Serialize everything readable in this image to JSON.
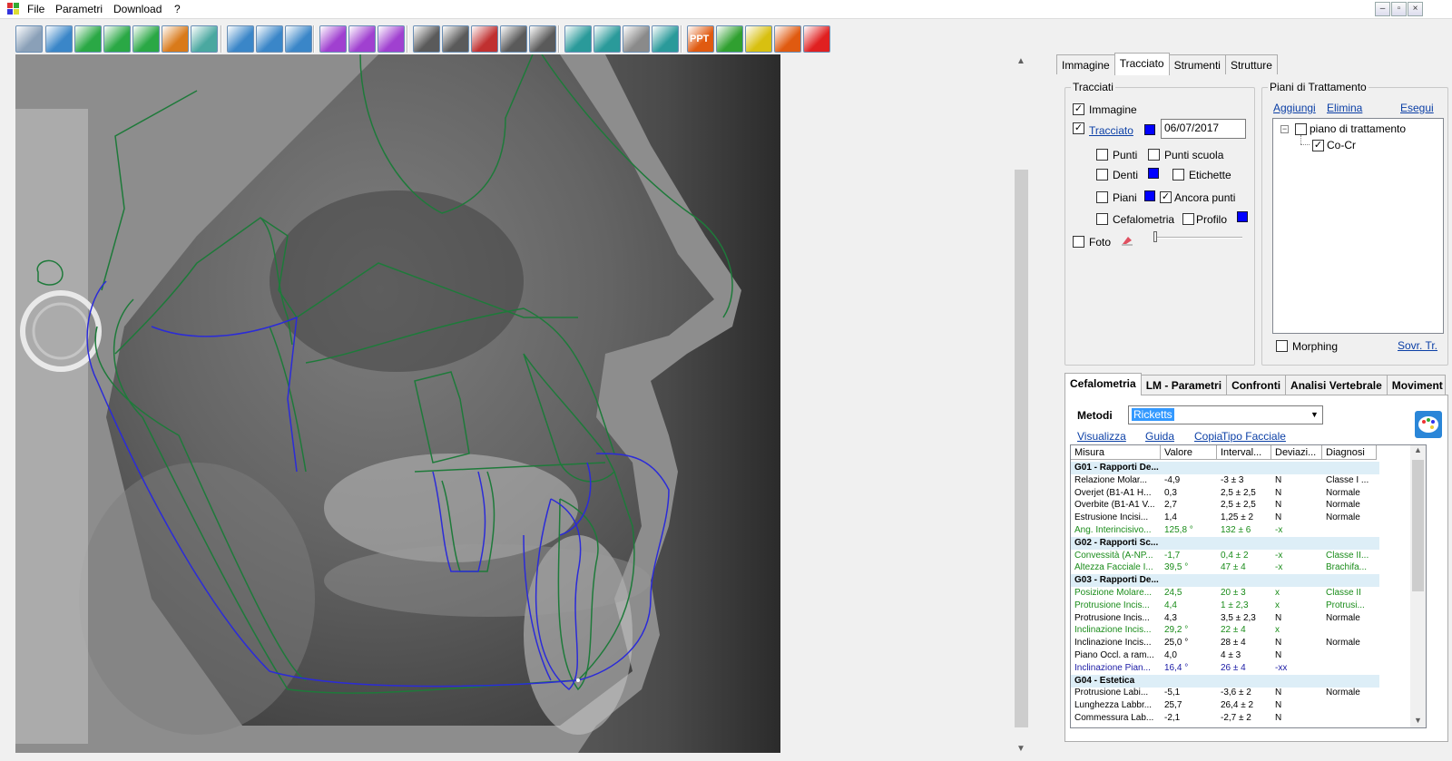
{
  "menubar": {
    "items": [
      "File",
      "Parametri",
      "Download",
      "?"
    ]
  },
  "window_controls": {
    "minimize": "–",
    "restore": "▫",
    "close": "×"
  },
  "toolbar": {
    "buttons": [
      {
        "name": "calibrate",
        "color": "#8aa0b8"
      },
      {
        "name": "zoom-point",
        "color": "#3a86c8"
      },
      {
        "name": "undo",
        "color": "#2aa845"
      },
      {
        "name": "redo",
        "color": "#2aa845"
      },
      {
        "name": "rotate",
        "color": "#2aa845"
      },
      {
        "name": "pointer",
        "color": "#d97a1a"
      },
      {
        "name": "magnify",
        "color": "#4aa8a0"
      },
      {
        "name": "patient",
        "color": "#3a86c8"
      },
      {
        "name": "patient-search",
        "color": "#3a86c8"
      },
      {
        "name": "profile",
        "color": "#3a86c8"
      },
      {
        "name": "flip-h",
        "color": "#a040d0"
      },
      {
        "name": "flip-v",
        "color": "#a040d0"
      },
      {
        "name": "flip-diag",
        "color": "#a040d0"
      },
      {
        "name": "face",
        "color": "#5a5a5a"
      },
      {
        "name": "pin",
        "color": "#5a5a5a"
      },
      {
        "name": "lip",
        "color": "#c03030"
      },
      {
        "name": "half-face",
        "color": "#5a5a5a"
      },
      {
        "name": "eye",
        "color": "#5a5a5a"
      },
      {
        "name": "print",
        "color": "#2a9a9a"
      },
      {
        "name": "print-preview",
        "color": "#2a9a9a"
      },
      {
        "name": "print-gray",
        "color": "#8a8a8a"
      },
      {
        "name": "printer-setup",
        "color": "#2a9a9a"
      },
      {
        "name": "ppt-export",
        "color": "#e05a10"
      },
      {
        "name": "check",
        "color": "#30a030"
      },
      {
        "name": "download",
        "color": "#d8c010"
      },
      {
        "name": "hand",
        "color": "#e05a10"
      },
      {
        "name": "exit",
        "color": "#e02020"
      }
    ],
    "ppt_label": "PPT"
  },
  "right_tabs": {
    "items": [
      "Immagine",
      "Tracciato",
      "Strumenti",
      "Strutture"
    ],
    "active": "Tracciato"
  },
  "tracciati": {
    "group_label": "Tracciati",
    "immagine": {
      "label": "Immagine",
      "checked": true
    },
    "tracciato": {
      "label": "Tracciato",
      "checked": true,
      "date": "06/07/2017",
      "color": "#0000ff"
    },
    "punti": {
      "label": "Punti",
      "checked": false
    },
    "punti_scuola": {
      "label": "Punti scuola",
      "checked": false
    },
    "denti": {
      "label": "Denti",
      "checked": false
    },
    "etichette": {
      "label": "Etichette",
      "checked": false
    },
    "piani": {
      "label": "Piani",
      "checked": false
    },
    "ancora_punti": {
      "label": "Ancora punti",
      "checked": true
    },
    "cefalometria": {
      "label": "Cefalometria",
      "checked": false
    },
    "profilo": {
      "label": "Profilo",
      "checked": false
    },
    "foto": {
      "label": "Foto",
      "checked": false
    }
  },
  "piani_trattamento": {
    "group_label": "Piani di Trattamento",
    "aggiungi": "Aggiungi",
    "elimina": "Elimina",
    "esegui": "Esegui",
    "tree_root": "piano di trattamento",
    "tree_child": "Co-Cr",
    "morphing": "Morphing",
    "sovr": "Sovr. Tr."
  },
  "bottom_tabs": {
    "items": [
      "Cefalometria",
      "LM - Parametri",
      "Confronti",
      "Analisi Vertebrale",
      "Moviment"
    ],
    "active": "Cefalometria"
  },
  "metodi": {
    "label": "Metodi",
    "selected": "Ricketts"
  },
  "actions": {
    "visualizza": "Visualizza",
    "guida": "Guida",
    "copia": "Copia",
    "tipo_facciale": "Tipo Facciale"
  },
  "grid": {
    "columns": [
      "Misura",
      "Valore",
      "Interval...",
      "Deviazi...",
      "Diagnosi"
    ],
    "rows": [
      {
        "type": "group",
        "misura": "G01 - Rapporti De..."
      },
      {
        "type": "normal",
        "misura": "Relazione Molar...",
        "valore": "-4,9",
        "intervallo": "-3 ± 3",
        "deviazione": "N",
        "diagnosi": "Classe I ..."
      },
      {
        "type": "normal",
        "misura": "Overjet (B1-A1 H...",
        "valore": "0,3",
        "intervallo": "2,5 ± 2,5",
        "deviazione": "N",
        "diagnosi": "Normale"
      },
      {
        "type": "normal",
        "misura": "Overbite (B1-A1 V...",
        "valore": "2,7",
        "intervallo": "2,5 ± 2,5",
        "deviazione": "N",
        "diagnosi": "Normale"
      },
      {
        "type": "normal",
        "misura": "Estrusione Incisi...",
        "valore": "1,4",
        "intervallo": "1,25 ± 2",
        "deviazione": "N",
        "diagnosi": "Normale"
      },
      {
        "type": "green",
        "misura": "Ang. Interincisivo...",
        "valore": "125,8 °",
        "intervallo": "132 ± 6",
        "deviazione": "-x",
        "diagnosi": ""
      },
      {
        "type": "group",
        "misura": "G02 - Rapporti Sc..."
      },
      {
        "type": "green",
        "misura": "Convessità (A-NP...",
        "valore": "-1,7",
        "intervallo": "0,4 ± 2",
        "deviazione": "-x",
        "diagnosi": "Classe II..."
      },
      {
        "type": "green",
        "misura": "Altezza Facciale I...",
        "valore": "39,5 °",
        "intervallo": "47 ± 4",
        "deviazione": "-x",
        "diagnosi": "Brachifa..."
      },
      {
        "type": "group",
        "misura": "G03 - Rapporti De..."
      },
      {
        "type": "green",
        "misura": "Posizione Molare...",
        "valore": "24,5",
        "intervallo": "20 ± 3",
        "deviazione": "x",
        "diagnosi": "Classe II"
      },
      {
        "type": "green",
        "misura": "Protrusione Incis...",
        "valore": "4,4",
        "intervallo": "1 ± 2,3",
        "deviazione": "x",
        "diagnosi": "Protrusi..."
      },
      {
        "type": "normal",
        "misura": "Protrusione Incis...",
        "valore": "4,3",
        "intervallo": "3,5 ± 2,3",
        "deviazione": "N",
        "diagnosi": "Normale"
      },
      {
        "type": "green",
        "misura": "Inclinazione Incis...",
        "valore": "29,2 °",
        "intervallo": "22 ± 4",
        "deviazione": "x",
        "diagnosi": ""
      },
      {
        "type": "normal",
        "misura": "Inclinazione Incis...",
        "valore": "25,0 °",
        "intervallo": "28 ± 4",
        "deviazione": "N",
        "diagnosi": "Normale"
      },
      {
        "type": "normal",
        "misura": "Piano Occl. a ram...",
        "valore": "4,0",
        "intervallo": "4 ± 3",
        "deviazione": "N",
        "diagnosi": ""
      },
      {
        "type": "blue",
        "misura": "Inclinazione Pian...",
        "valore": "16,4 °",
        "intervallo": "26 ± 4",
        "deviazione": "-xx",
        "diagnosi": ""
      },
      {
        "type": "group",
        "misura": "G04 - Estetica"
      },
      {
        "type": "normal",
        "misura": "Protrusione Labi...",
        "valore": "-5,1",
        "intervallo": "-3,6 ± 2",
        "deviazione": "N",
        "diagnosi": "Normale"
      },
      {
        "type": "normal",
        "misura": "Lunghezza Labbr...",
        "valore": "25,7",
        "intervallo": "26,4 ± 2",
        "deviazione": "N",
        "diagnosi": ""
      },
      {
        "type": "normal",
        "misura": "Commessura Lab...",
        "valore": "-2,1",
        "intervallo": "-2,7 ± 2",
        "deviazione": "N",
        "diagnosi": ""
      }
    ]
  },
  "colors": {
    "trace_green": "#1e7a3a",
    "trace_blue": "#2b2bd8",
    "link": "#0b3fa6",
    "highlight": "#3399ff"
  }
}
